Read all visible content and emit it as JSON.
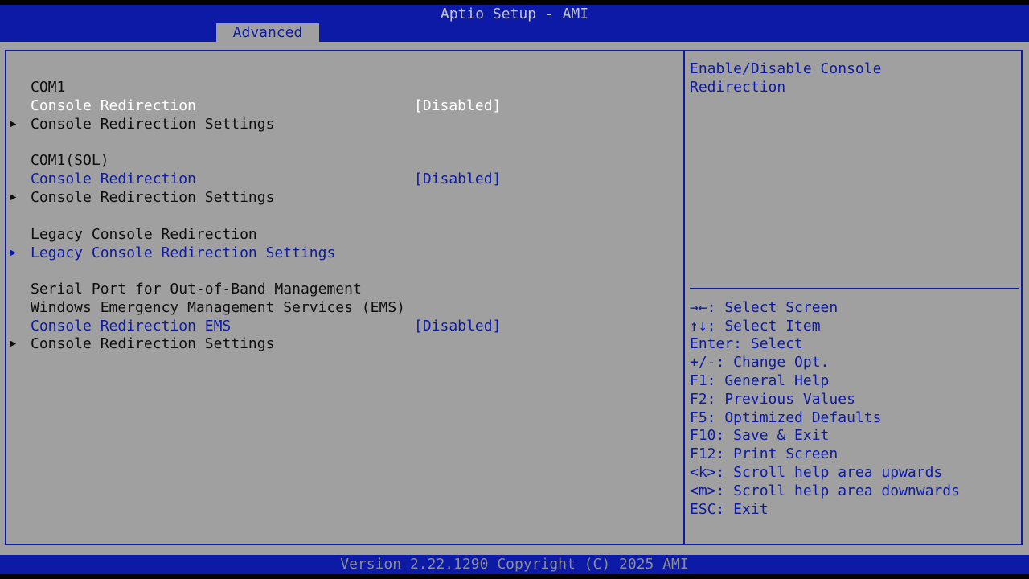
{
  "header": {
    "title": "Aptio Setup - AMI",
    "active_tab": "Advanced"
  },
  "menu": {
    "com1": {
      "heading": "COM1",
      "console_redirection": {
        "label": "Console Redirection",
        "value": "[Disabled]"
      },
      "settings": {
        "label": "Console Redirection Settings"
      }
    },
    "com1_sol": {
      "heading": "COM1(SOL)",
      "console_redirection": {
        "label": "Console Redirection",
        "value": "[Disabled]"
      },
      "settings": {
        "label": "Console Redirection Settings"
      }
    },
    "legacy": {
      "heading": "Legacy Console Redirection",
      "settings": {
        "label": "Legacy Console Redirection Settings"
      }
    },
    "ems": {
      "heading1": "Serial Port for Out-of-Band Management",
      "heading2": "Windows Emergency Management Services (EMS)",
      "console_redirection": {
        "label": "Console Redirection EMS",
        "value": "[Disabled]"
      },
      "settings": {
        "label": "Console Redirection Settings"
      }
    }
  },
  "help": {
    "description_line1": "Enable/Disable Console",
    "description_line2": "Redirection",
    "keys": [
      "→←: Select Screen",
      "↑↓: Select Item",
      "Enter: Select",
      "+/-: Change Opt.",
      "F1: General Help",
      "F2: Previous Values",
      "F5: Optimized Defaults",
      "F10: Save & Exit",
      "F12: Print Screen",
      "<k>: Scroll help area upwards",
      "<m>: Scroll help area downwards",
      "ESC: Exit"
    ]
  },
  "footer": {
    "version": "Version 2.22.1290 Copyright (C) 2025 AMI"
  },
  "colors": {
    "accent_blue": "#0c1aa6",
    "panel_gray": "#a0a0a0",
    "highlight_white": "#ffffff"
  }
}
